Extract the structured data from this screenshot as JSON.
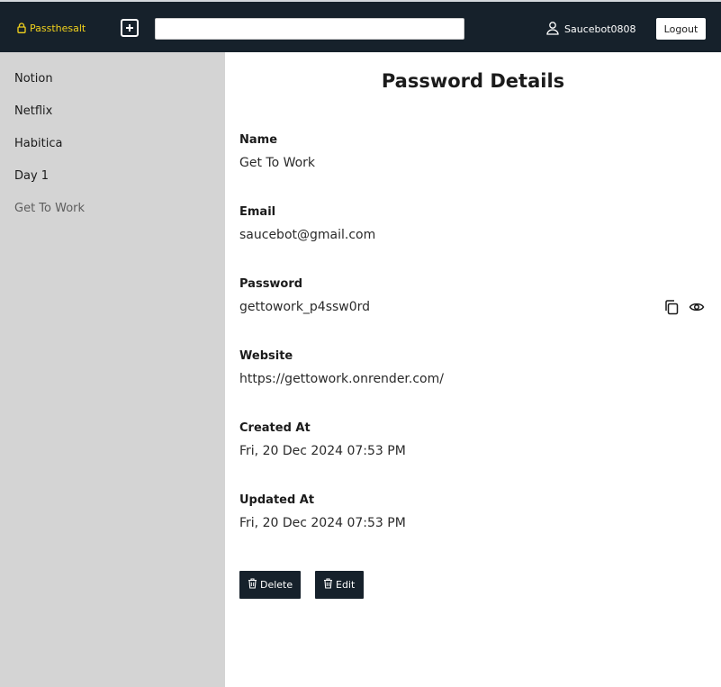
{
  "header": {
    "brand": "Passthesalt",
    "search_value": "",
    "username": "Saucebot0808",
    "logout_label": "Logout"
  },
  "sidebar": {
    "items": [
      {
        "label": "Notion",
        "active": false
      },
      {
        "label": "Netflix",
        "active": false
      },
      {
        "label": "Habitica",
        "active": false
      },
      {
        "label": "Day 1",
        "active": false
      },
      {
        "label": "Get To Work",
        "active": true
      }
    ]
  },
  "details": {
    "title": "Password Details",
    "name_label": "Name",
    "name_value": "Get To Work",
    "email_label": "Email",
    "email_value": "saucebot@gmail.com",
    "password_label": "Password",
    "password_value": "gettowork_p4ssw0rd",
    "website_label": "Website",
    "website_value": "https://gettowork.onrender.com/",
    "created_label": "Created At",
    "created_value": "Fri, 20 Dec 2024 07:53 PM",
    "updated_label": "Updated At",
    "updated_value": "Fri, 20 Dec 2024 07:53 PM"
  },
  "actions": {
    "delete_label": "Delete",
    "edit_label": "Edit"
  },
  "icons": {
    "brand": "lock-icon",
    "add": "plus-square-icon",
    "user": "user-icon",
    "copy": "copy-icon",
    "reveal": "eye-icon",
    "delete": "trash-icon",
    "edit": "trash-icon"
  },
  "colors": {
    "topbar": "#16212b",
    "brand": "#f2d21c",
    "sidebar": "#d4d4d4",
    "button": "#16212b"
  }
}
